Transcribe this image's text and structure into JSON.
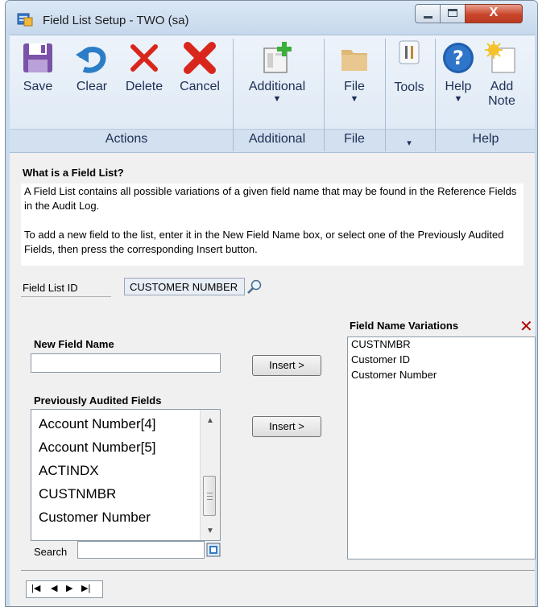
{
  "window": {
    "title": "Field List Setup  -  TWO (sa)",
    "close_glyph": "X"
  },
  "ribbon": {
    "save": "Save",
    "clear": "Clear",
    "delete": "Delete",
    "cancel": "Cancel",
    "additional": "Additional",
    "file": "File",
    "tools": "Tools",
    "help": "Help",
    "add_note_line1": "Add",
    "add_note_line2": "Note",
    "groups": {
      "actions": "Actions",
      "additional": "Additional",
      "file": "File",
      "help": "Help"
    }
  },
  "info": {
    "heading": "What is a Field List?",
    "para1": "A Field List contains all possible variations of a given field name that may be found in the Reference Fields in the Audit Log.",
    "para2": "To add a new field to the list, enter it in the New Field Name box, or select one of the Previously Audited Fields, then press the corresponding Insert button."
  },
  "form": {
    "field_list_id_label": "Field List ID",
    "field_list_id_value": "CUSTOMER NUMBER",
    "new_field_name_label": "New Field Name",
    "new_field_name_value": "",
    "previously_audited_label": "Previously Audited Fields",
    "previously_audited_items": [
      "Account Number[4]",
      "Account Number[5]",
      "ACTINDX",
      "CUSTNMBR",
      "Customer Number"
    ],
    "insert_label": "Insert >",
    "search_label": "Search",
    "search_value": "",
    "variations_label": "Field Name Variations",
    "variations": [
      "CUSTNMBR",
      "Customer ID",
      "Customer Number"
    ]
  },
  "colors": {
    "ribbon_text": "#1d2f55",
    "delete_red": "#d9261c",
    "help_blue": "#1f5fb0"
  }
}
